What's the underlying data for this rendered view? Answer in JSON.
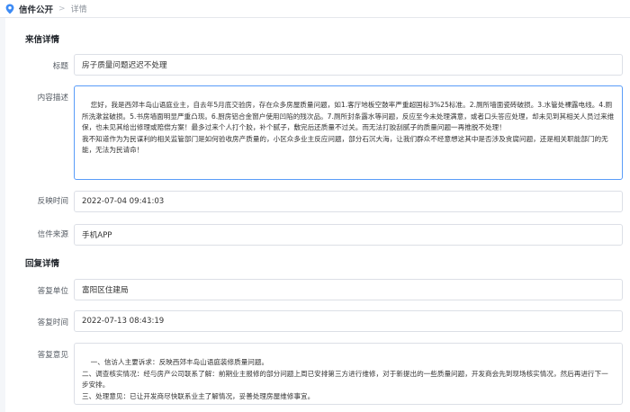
{
  "breadcrumb": {
    "home": "信件公开",
    "separator": ">",
    "current": "详情"
  },
  "letter": {
    "section_title": "来信详情",
    "title_label": "标题",
    "title_value": "房子质量问题迟迟不处理",
    "content_label": "内容描述",
    "content_value": "您好，我是西郊丰岛山语庭业主，自去年5月底交验房，存在众多房屋质量问题，如1.客厅地板空鼓率严重超国标3%25标准。2.厕所墙面瓷砖破损。3.水管处裸露电线。4.厕所洗漱盆破损。5.书房墙面明显严重凸现。6.厨房铝合金窗户使用凹陷的残次品。7.厕所封条露水等问题，反应至今未处理满意，或者口头答应处理，却未见到其相关人员过来维保，也未见其给出修理或赔偿方案！最多过来个人打个胶，补个腻子，敷完后还质量不过关。而无法打胶刮腻子的质量问题一再推脱不处理！\n我不知道作为为民谋利的相关监管部门是如何验收房产质量的，小区众多业主反应问题，部分石沉大海，让我们群众不经意想这其中是否涉及贪腐问题，还是相关职能部门的无能，无法为民请命！",
    "time_label": "反映时间",
    "time_value": "2022-07-04 09:41:03",
    "source_label": "信件来源",
    "source_value": "手机APP"
  },
  "reply": {
    "section_title": "回复详情",
    "unit_label": "答复单位",
    "unit_value": "富阳区住建局",
    "time_label": "答复时间",
    "time_value": "2022-07-13 08:43:19",
    "opinion_label": "答复意见",
    "opinion_value": "一、信访人主要诉求：反映西郊丰岛山语庭装修质量问题。\n二、调查核实情况：经与房产公司联系了解：前期业主报修的部分问题上周已安排第三方进行维修，对于新提出的一些质量问题，开发商会先到现场核实情况，然后再进行下一步安排。\n三、处理意见：已让开发商尽快联系业主了解情况，妥善处理房屋维修事宜。"
  },
  "colors": {
    "accent": "#3d8bf5",
    "focus_border": "#5a9cf8",
    "border": "#dcdfe6"
  }
}
